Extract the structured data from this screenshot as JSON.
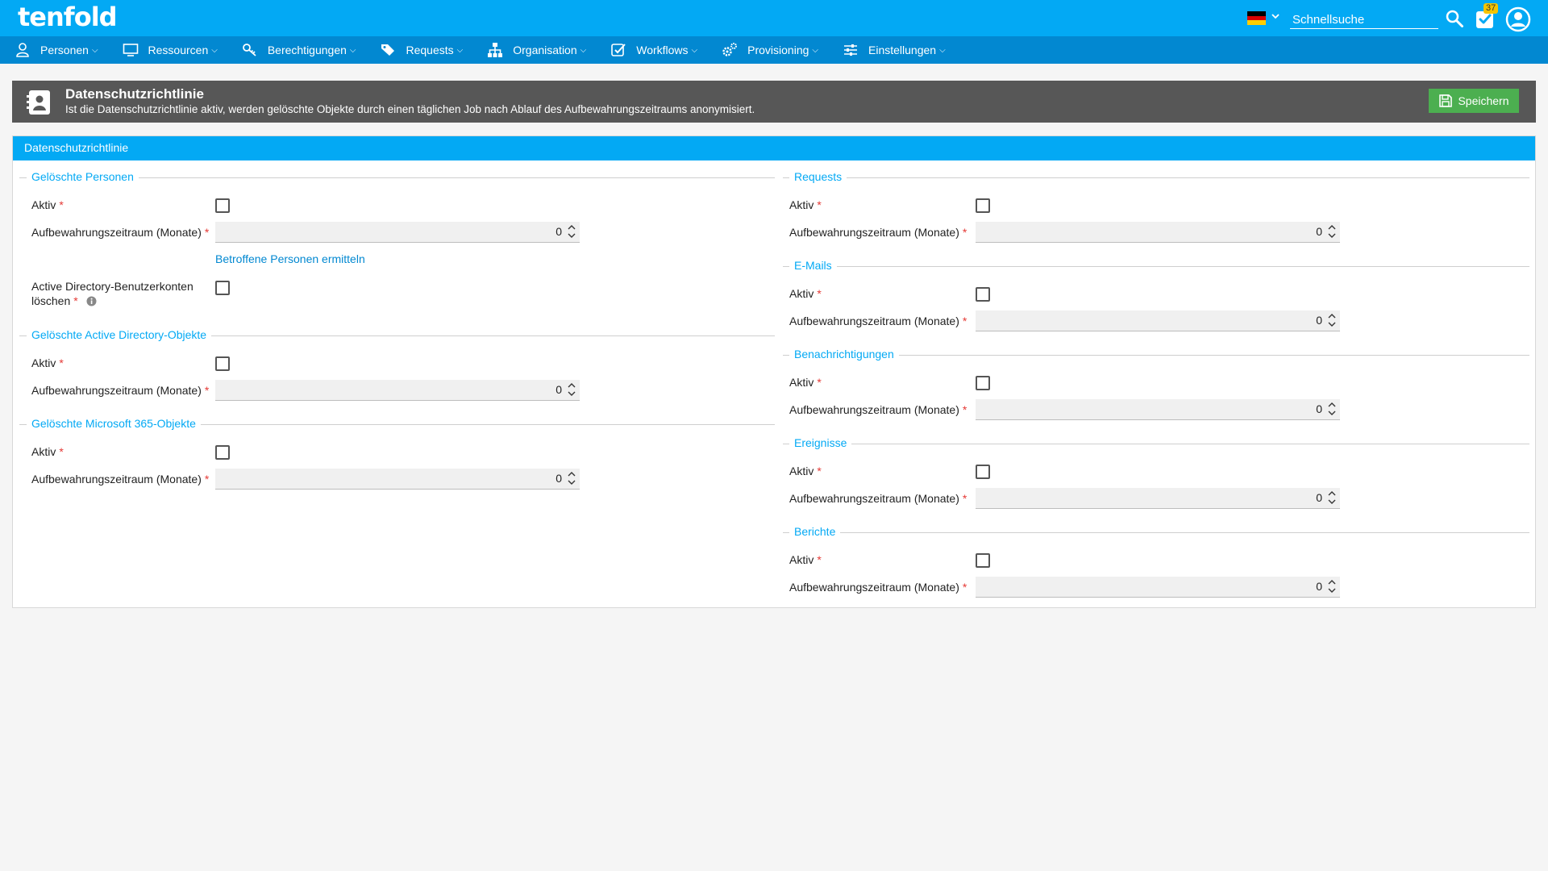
{
  "app": {
    "logo": "tenfold"
  },
  "topbar": {
    "search_placeholder": "Schnellsuche",
    "tasks_badge": "37",
    "flag_colors": [
      "#000000",
      "#dd0000",
      "#ffce00"
    ]
  },
  "nav": {
    "items": [
      {
        "label": "Personen",
        "icon": "person-icon"
      },
      {
        "label": "Ressourcen",
        "icon": "monitor-icon"
      },
      {
        "label": "Berechtigungen",
        "icon": "key-icon"
      },
      {
        "label": "Requests",
        "icon": "tags-icon"
      },
      {
        "label": "Organisation",
        "icon": "org-chart-icon"
      },
      {
        "label": "Workflows",
        "icon": "checkbox-icon"
      },
      {
        "label": "Provisioning",
        "icon": "gears-icon"
      },
      {
        "label": "Einstellungen",
        "icon": "sliders-icon"
      }
    ]
  },
  "header": {
    "title": "Datenschutzrichtlinie",
    "description": "Ist die Datenschutzrichtlinie aktiv, werden gelöschte Objekte durch einen täglichen Job nach Ablauf des Aufbewahrungszeitraums anonymisiert.",
    "save_label": "Speichern"
  },
  "form": {
    "title": "Datenschutzrichtlinie",
    "labels": {
      "active": "Aktiv",
      "retention": "Aufbewahrungszeitraum (Monate)",
      "ad_delete_line1": "Active Directory-Benutzerkonten",
      "ad_delete_line2": "löschen",
      "required_mark": "*"
    },
    "link_affected": "Betroffene Personen ermitteln",
    "sections": {
      "deleted_persons": {
        "title": "Gelöschte Personen",
        "retention_value": "0"
      },
      "deleted_ad": {
        "title": "Gelöschte Active Directory-Objekte",
        "retention_value": "0"
      },
      "deleted_m365": {
        "title": "Gelöschte Microsoft 365-Objekte",
        "retention_value": "0"
      },
      "requests": {
        "title": "Requests",
        "retention_value": "0"
      },
      "emails": {
        "title": "E-Mails",
        "retention_value": "0"
      },
      "notifications": {
        "title": "Benachrichtigungen",
        "retention_value": "0"
      },
      "events": {
        "title": "Ereignisse",
        "retention_value": "0"
      },
      "reports": {
        "title": "Berichte",
        "retention_value": "0"
      }
    }
  },
  "colors": {
    "topbar": "#03a9f4",
    "navbar": "#0288d1",
    "header": "#575757",
    "save": "#4caf50",
    "required": "#e53935"
  }
}
